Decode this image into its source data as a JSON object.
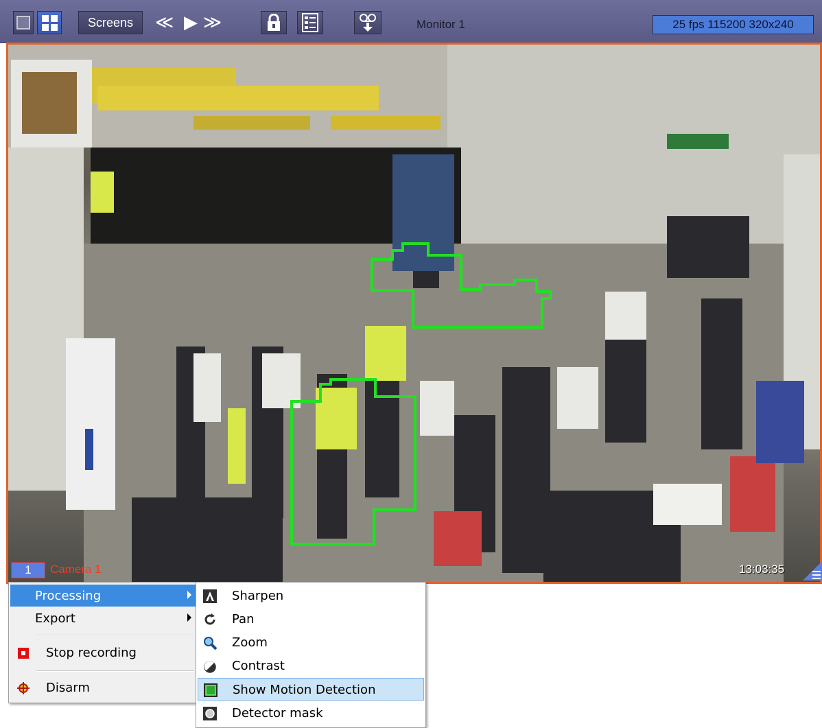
{
  "toolbar": {
    "screens_label": "Screens",
    "nav_prev": "≪",
    "nav_play": "▶",
    "nav_next": "≫",
    "monitor_label": "Monitor 1",
    "stream_info": "25 fps 115200 320x240"
  },
  "camera": {
    "number": "1",
    "name": "Camera 1",
    "timestamp": "13:03:35"
  },
  "context_menu": {
    "items": [
      {
        "label": "Processing",
        "has_submenu": true,
        "highlighted": true
      },
      {
        "label": "Export",
        "has_submenu": true
      },
      {
        "label": "Stop recording",
        "icon": "stop-record-icon"
      },
      {
        "label": "Disarm",
        "icon": "disarm-icon"
      }
    ]
  },
  "submenu": {
    "items": [
      {
        "label": "Sharpen",
        "icon": "sharpen-icon"
      },
      {
        "label": "Pan",
        "icon": "pan-icon"
      },
      {
        "label": "Zoom",
        "icon": "zoom-icon"
      },
      {
        "label": "Contrast",
        "icon": "contrast-icon"
      },
      {
        "label": "Show Motion Detection",
        "icon": "motion-detection-icon",
        "highlighted": true
      },
      {
        "label": "Detector mask",
        "icon": "detector-mask-icon"
      }
    ]
  },
  "colors": {
    "toolbar": "#5f5f8c",
    "frame_border": "#e0622a",
    "menu_highlight": "#3b8be0",
    "submenu_highlight": "#cce4f7",
    "motion_box": "#22e022"
  }
}
